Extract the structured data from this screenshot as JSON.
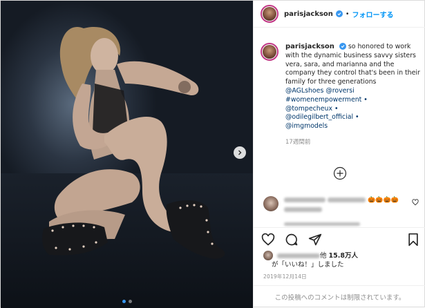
{
  "header": {
    "username": "parisjackson",
    "separator": "•",
    "follow_label": "フォローする"
  },
  "caption": {
    "username": "parisjackson",
    "text": "so honored to work with the dynamic business savvy sisters vera, sara, and marianna and the company they control that's been in their family for three generations",
    "tags": [
      "@AGLshoes",
      "@roversi",
      "#womenempowerment •",
      "@tompecheux •",
      "@odilegilbert_official •",
      "@imgmodels"
    ],
    "time_ago": "17週間前"
  },
  "comment": {
    "emoji": "🎃🎃🎃🎃"
  },
  "likes": {
    "prefix": "他",
    "count": "15.8万人",
    "suffix": "が「いいね！」しました"
  },
  "date": "2019年12月14日",
  "comment_box": {
    "restricted_text": "この投稿へのコメントは制限されています。"
  },
  "carousel": {
    "slide_count": 2,
    "active_index": 0
  },
  "colors": {
    "accent": "#0095f6",
    "verified": "#3897f0",
    "avatar_ring": "#c13584",
    "muted": "#8e8e8e"
  },
  "icons": {
    "verified": "verified-badge-icon",
    "next": "chevron-right-icon",
    "load_more": "plus-circle-icon",
    "like": "heart-icon",
    "comment": "comment-icon",
    "share": "paper-plane-icon",
    "save": "bookmark-icon"
  }
}
